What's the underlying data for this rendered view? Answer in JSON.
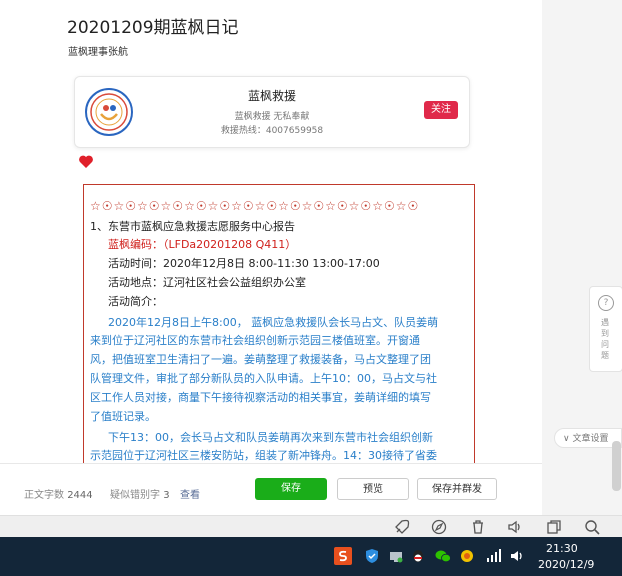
{
  "article": {
    "title": "20201209期蓝枫日记",
    "author": "蓝枫理事张航"
  },
  "account_card": {
    "name": "蓝枫救援",
    "description": "蓝枫救援 无私奉献",
    "phone": "救援热线：4007659958",
    "follow_label": "关注"
  },
  "body": {
    "stars": "☆☉☆☉☆☉☆☉☆☉☆☉☆☉☆☉☆☉☆☉☆☉☆☉☆☉☆☉",
    "lines": [
      "1、东营市蓝枫应急救援志愿服务中心报告",
      "蓝枫编码：（LFDa20201208  Q411）",
      "活动时间：2020年12月8日  8:00-11:30     13:00-17:00",
      "活动地点：辽河社区社会公益组织办公室",
      "活动简介：",
      "2020年12月8日上午8:00，  蓝枫应急救援队会长马占文、队员姜萌",
      "来到位于辽河社区的东营市社会组织创新示范园三楼值班室。开窗通",
      "风，把值班室卫生清扫了一遍。姜萌整理了救援装备，马占文整理了团",
      "队管理文件，审批了部分新队员的入队申请。上午10：00，马占文与社",
      "区工作人员对接，商量下午接待视察活动的相关事宜，姜萌详细的填写",
      "了值班记录。",
      "下午13：00，会长马占文和队员姜萌再次来到东营市社会组织创新",
      "示范园位于辽河社区三楼安防站，组装了新冲锋舟。14：30接待了省委"
    ]
  },
  "footer": {
    "word_count_label": "正文字数",
    "word_count": "2444",
    "typo_label": "疑似错别字",
    "typo_count": "3",
    "view_label": "查看",
    "save_label": "保存",
    "preview_label": "预览",
    "save_publish_label": "保存并群发"
  },
  "side": {
    "help_label": "遇到问题",
    "doc_settings_label": "文章设置"
  },
  "nav_icons": [
    "rocket-icon",
    "compass-icon",
    "trash-icon",
    "speaker-icon",
    "copy-icon",
    "search-icon"
  ],
  "taskbar": {
    "time": "21:30",
    "date": "2020/12/9"
  },
  "colors": {
    "accent_green": "#1aad19",
    "follow_red": "#e0294a",
    "text_red": "#d0211c",
    "text_blue": "#2a7fc9",
    "taskbar": "#132639"
  }
}
